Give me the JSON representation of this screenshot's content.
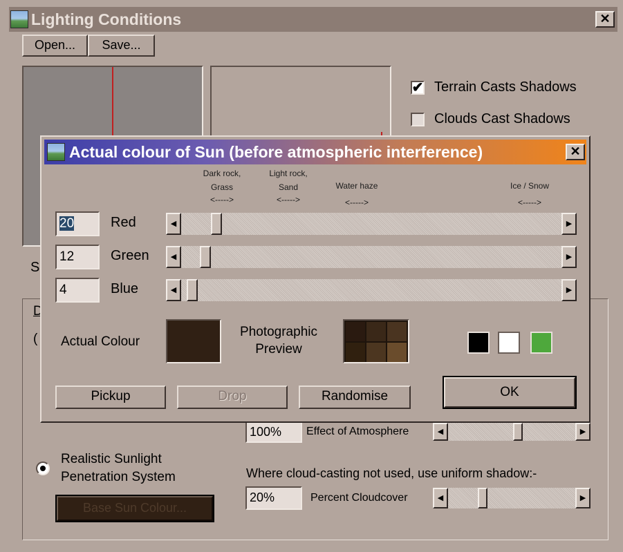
{
  "main_window": {
    "title": "Lighting Conditions",
    "close_glyph": "✕",
    "menu": {
      "open_label": "Open...",
      "save_label": "Save..."
    },
    "checkboxes": [
      {
        "label": "Terrain Casts Shadows",
        "checked": true
      },
      {
        "label": "Clouds Cast Shadows",
        "checked": false
      }
    ],
    "partial_label_left": "S",
    "partial_group_letter": "D",
    "partial_paren": "(",
    "atmosphere": {
      "value": "100%",
      "label": "Effect of Atmosphere",
      "level": 0.55
    },
    "sunlight_radio": {
      "line1": "Realistic Sunlight",
      "line2": "Penetration System",
      "selected": true
    },
    "base_sun_button": "Base Sun Colour...",
    "cloud_note": "Where cloud-casting not used, use uniform shadow:-",
    "cloudcover": {
      "value": "20%",
      "label": "Percent Cloudcover",
      "level": 0.25
    }
  },
  "dialog": {
    "title": "Actual colour of Sun (before atmospheric interference)",
    "close_glyph": "✕",
    "markers": [
      {
        "line1": "Dark rock,",
        "line2": "Grass",
        "arrow": "<----->"
      },
      {
        "line1": "Light rock,",
        "line2": "Sand",
        "arrow": "<----->"
      },
      {
        "line1": "Water haze",
        "line2": "",
        "arrow": "<----->"
      },
      {
        "line1": "Ice / Snow",
        "line2": "",
        "arrow": "<----->"
      }
    ],
    "channels": [
      {
        "value": "20",
        "label": "Red",
        "level": 0.08
      },
      {
        "value": "12",
        "label": "Green",
        "level": 0.05
      },
      {
        "value": "4",
        "label": "Blue",
        "level": 0.015
      }
    ],
    "actual_colour_label": "Actual Colour",
    "actual_colour": "#302014",
    "preview_label_line1": "Photographic",
    "preview_label_line2": "Preview",
    "preview_grid": [
      "#2a1a10",
      "#3a2818",
      "#4a3420",
      "#30200f",
      "#4c3620",
      "#6a4c2c"
    ],
    "swatches": [
      "#000000",
      "#ffffff",
      "#4ea83c"
    ],
    "buttons": {
      "pickup": "Pickup",
      "drop": "Drop",
      "randomise": "Randomise",
      "ok": "OK"
    },
    "slider_arrow_left": "◀",
    "slider_arrow_right": "▶"
  }
}
